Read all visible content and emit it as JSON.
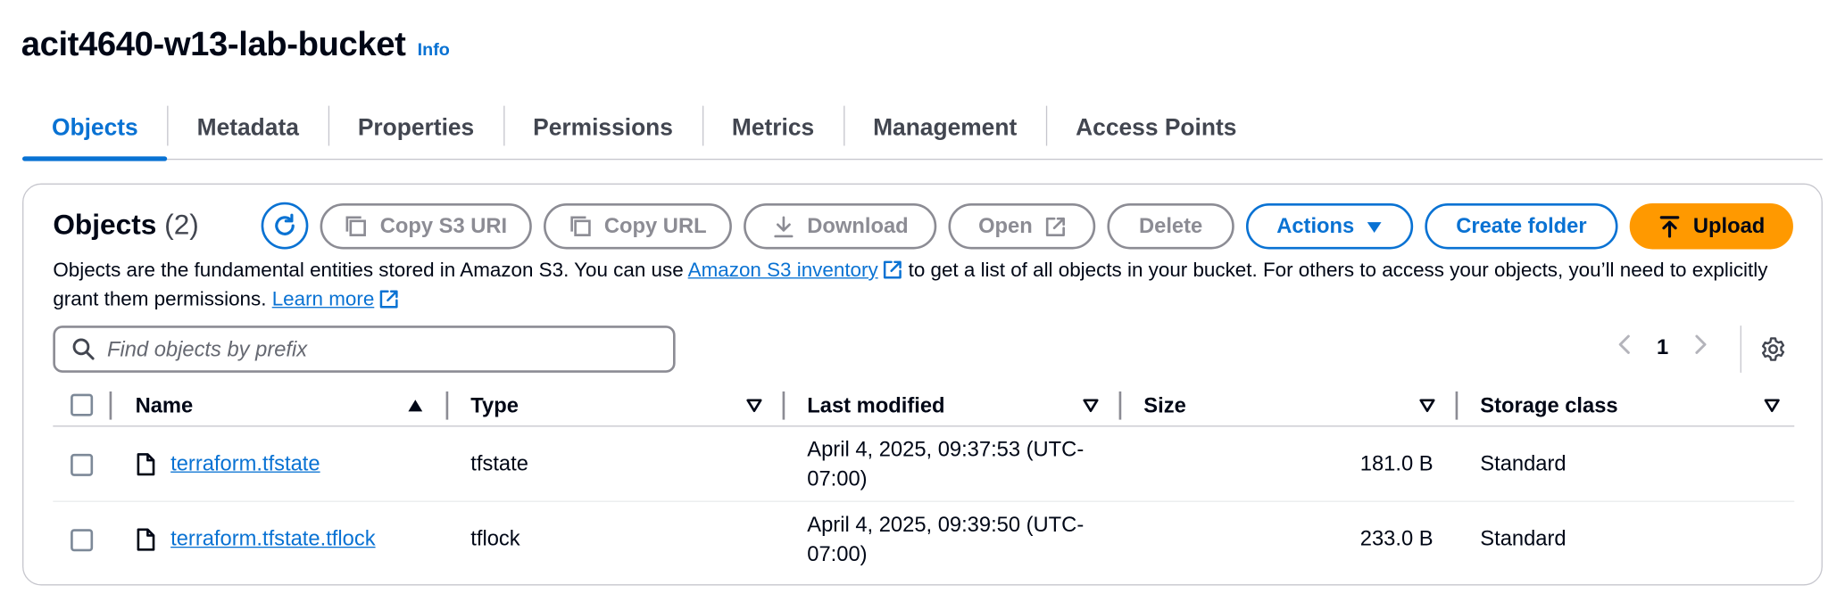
{
  "bucket": {
    "title": "acit4640-w13-lab-bucket",
    "info_label": "Info"
  },
  "tabs": [
    {
      "label": "Objects",
      "active": true
    },
    {
      "label": "Metadata"
    },
    {
      "label": "Properties"
    },
    {
      "label": "Permissions"
    },
    {
      "label": "Metrics"
    },
    {
      "label": "Management"
    },
    {
      "label": "Access Points"
    }
  ],
  "objects_panel": {
    "title": "Objects",
    "count": "(2)",
    "buttons": {
      "copy_s3_uri": "Copy S3 URI",
      "copy_url": "Copy URL",
      "download": "Download",
      "open": "Open",
      "delete": "Delete",
      "actions": "Actions",
      "create_folder": "Create folder",
      "upload": "Upload"
    },
    "description": {
      "part1": "Objects are the fundamental entities stored in Amazon S3. You can use ",
      "inventory_link": "Amazon S3 inventory",
      "part2": " to get a list of all objects in your bucket. For others to access your objects, you’ll need to explicitly grant them permissions. ",
      "learn_more": "Learn more"
    },
    "search": {
      "placeholder": "Find objects by prefix",
      "value": ""
    },
    "pagination": {
      "current_page": "1"
    }
  },
  "table": {
    "columns": {
      "name": "Name",
      "type": "Type",
      "last_modified": "Last modified",
      "size": "Size",
      "storage_class": "Storage class"
    },
    "rows": [
      {
        "name": "terraform.tfstate",
        "type": "tfstate",
        "last_modified_line1": "April 4, 2025, 09:37:53 (UTC-",
        "last_modified_line2": "07:00)",
        "size": "181.0 B",
        "storage_class": "Standard"
      },
      {
        "name": "terraform.tfstate.tflock",
        "type": "tflock",
        "last_modified_line1": "April 4, 2025, 09:39:50 (UTC-",
        "last_modified_line2": "07:00)",
        "size": "233.0 B",
        "storage_class": "Standard"
      }
    ]
  },
  "colors": {
    "accent": "#0972d3",
    "upload": "#ff9900",
    "disabled": "#8c8c94",
    "text": "#000716"
  }
}
